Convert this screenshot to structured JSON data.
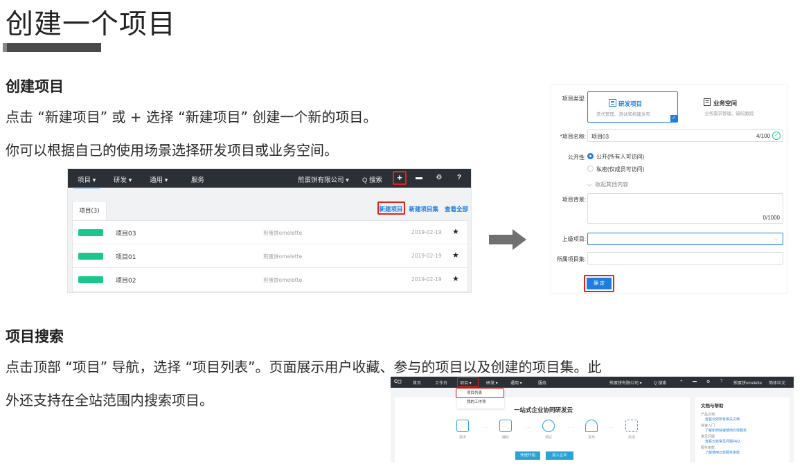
{
  "page": {
    "title": "创建一个项目",
    "section1": {
      "heading": "创建项目",
      "line1": "点击 “新建项目” 或 + 选择 “新建项目” 创建一个新的项目。",
      "line2": "你可以根据自己的使用场景选择研发项目或业务空间。"
    },
    "section2": {
      "heading": "项目搜索",
      "line1": "点击顶部 “项目” 导航，选择 “项目列表”。页面展示用户收藏、参与的项目以及创建的项目集。此",
      "line2": "外还支持在全站范围内搜索项目。"
    }
  },
  "list_shot": {
    "nav": {
      "items": [
        "项目 ▾",
        "研发 ▾",
        "通用 ▾",
        "服务"
      ],
      "company": "煎蛋饼有限公司 ▾",
      "search": "Q 搜索",
      "plus_icon": "+",
      "inbox_icon": "▬",
      "gear_icon": "⚙",
      "help_icon": "?"
    },
    "tab_label": "项目(3)",
    "actions": [
      "新建项目",
      "新建项目集",
      "查看全部"
    ],
    "rows": [
      {
        "name": "项目03",
        "owner": "煎蛋饼omelette",
        "date": "2019-02-19",
        "star": "★"
      },
      {
        "name": "项目01",
        "owner": "煎蛋饼omelette",
        "date": "2019-02-19",
        "star": "★"
      },
      {
        "name": "项目02",
        "owner": "煎蛋饼omelette",
        "date": "2019-02-19",
        "star": "★"
      }
    ],
    "accent": "#19c78a",
    "highlight": "#e2231a"
  },
  "form_shot": {
    "type_label": "项目类型:",
    "type_selected": {
      "title": "研发项目",
      "desc": "迭代管理、测试和构建发布",
      "icon": "list-icon"
    },
    "type_other": {
      "title": "业务空间",
      "desc": "业务需求管理、缺陷跟踪",
      "icon": "doc-icon"
    },
    "name_label": "*项目名称:",
    "name_value": "项目03",
    "name_count": "4/100",
    "visibility_label": "公开性:",
    "visibility_public": "公开(所有人可访问)",
    "visibility_private": "私密(仅成员可访问)",
    "collapse_text": "收起其他内容",
    "background_label": "项目背景:",
    "background_count": "0/1000",
    "parent_label": "上级项目:",
    "set_label": "所属项目集:",
    "confirm_label": "确 定",
    "accent": "#1e7ee0"
  },
  "dashboard_shot": {
    "logo": "C◻",
    "nav": [
      "首页",
      "工作台",
      "项目 ▾",
      "研发 ▾",
      "通用 ▾",
      "服务"
    ],
    "nav_right": [
      "煎蛋饼有限公司 ▾",
      "Q 搜索",
      "+",
      "▬",
      "⚙",
      "?",
      "煎蛋饼omelette",
      "简体中文"
    ],
    "dropdown": [
      "项目列表",
      "我的工作项"
    ],
    "headline": "一站式企业协同研发云",
    "steps": [
      "需求",
      "编码",
      "测试",
      "发布",
      "反馈"
    ],
    "buttons": [
      "快速开始",
      "加入企业"
    ],
    "help": {
      "title": "文档与帮助",
      "groups": [
        {
          "label": "产品文档",
          "link": "查看云效所有相关文档"
        },
        {
          "label": "快速入门",
          "link": "了解如何快速使用云效服务"
        },
        {
          "label": "常见问题",
          "link": "查看云效常见问题FAQ"
        },
        {
          "label": "服务条款",
          "link": "了解使用云效服务条款"
        }
      ]
    }
  }
}
